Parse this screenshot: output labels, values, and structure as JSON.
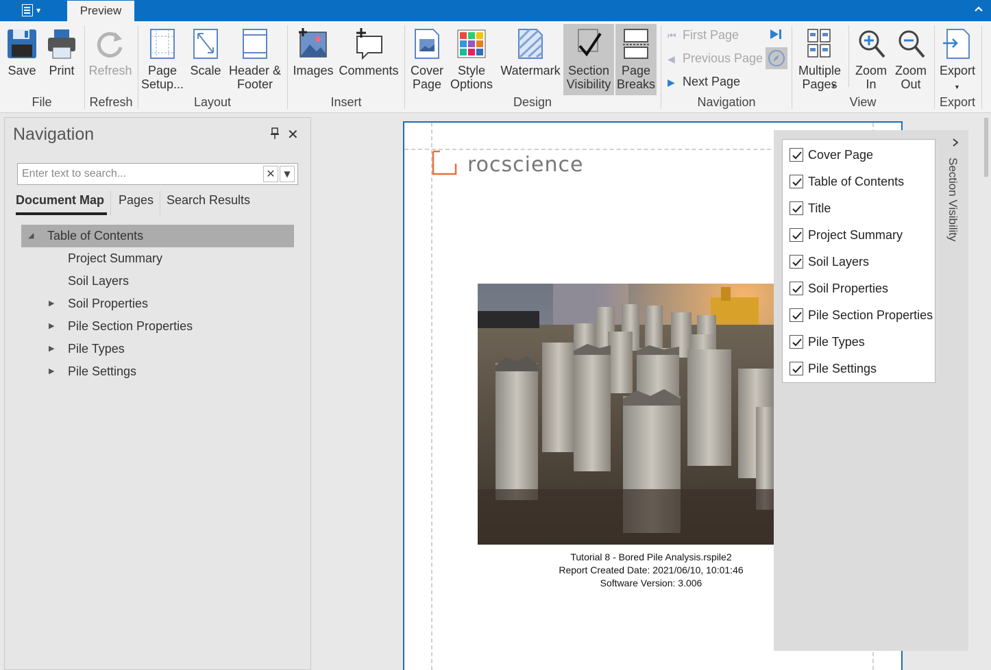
{
  "titlebar": {
    "tab_label": "Preview"
  },
  "ribbon": {
    "groups": {
      "file": "File",
      "refresh": "Refresh",
      "layout": "Layout",
      "insert": "Insert",
      "design": "Design",
      "navigation": "Navigation",
      "view": "View",
      "export": "Export"
    },
    "buttons": {
      "save": "Save",
      "print": "Print",
      "refresh": "Refresh",
      "page_setup": "Page\nSetup...",
      "scale": "Scale",
      "header_footer": "Header &\nFooter",
      "images": "Images",
      "comments": "Comments",
      "cover_page": "Cover\nPage",
      "style_options": "Style\nOptions",
      "watermark": "Watermark",
      "section_visibility": "Section\nVisibility",
      "page_breaks": "Page\nBreaks",
      "multiple_pages": "Multiple\nPages",
      "zoom_in": "Zoom\nIn",
      "zoom_out": "Zoom\nOut",
      "export": "Export"
    },
    "navigation": {
      "first_page": "First Page",
      "previous_page": "Previous Page",
      "next_page": "Next Page"
    }
  },
  "nav_panel": {
    "title": "Navigation",
    "search_placeholder": "Enter text to search...",
    "tabs": [
      "Document Map",
      "Pages",
      "Search Results"
    ],
    "tree": [
      {
        "label": "Table of Contents",
        "level": 0,
        "expanded": true,
        "selected": true
      },
      {
        "label": "Project Summary",
        "level": 1,
        "expandable": false
      },
      {
        "label": "Soil Layers",
        "level": 1,
        "expandable": false
      },
      {
        "label": "Soil Properties",
        "level": 1,
        "expandable": true
      },
      {
        "label": "Pile Section Properties",
        "level": 1,
        "expandable": true
      },
      {
        "label": "Pile Types",
        "level": 1,
        "expandable": true
      },
      {
        "label": "Pile Settings",
        "level": 1,
        "expandable": true
      }
    ]
  },
  "document": {
    "logo_text": "rocscience",
    "file_name": "Tutorial 8 - Bored Pile Analysis.rspile2",
    "created": "Report Created Date: 2021/06/10, 10:01:46",
    "version": "Software Version: 3.006"
  },
  "section_visibility": {
    "title": "Section Visibility",
    "items": [
      {
        "label": "Cover Page",
        "checked": true
      },
      {
        "label": "Table of Contents",
        "checked": true
      },
      {
        "label": "Title",
        "checked": true
      },
      {
        "label": "Project Summary",
        "checked": true
      },
      {
        "label": "Soil Layers",
        "checked": true
      },
      {
        "label": "Soil Properties",
        "checked": true
      },
      {
        "label": "Pile Section Properties",
        "checked": true
      },
      {
        "label": "Pile Types",
        "checked": true
      },
      {
        "label": "Pile Settings",
        "checked": true
      }
    ]
  },
  "colors": {
    "titlebar": "#0a6fc2",
    "accent": "#2f7fd1",
    "logo_orange": "#e8703a"
  }
}
